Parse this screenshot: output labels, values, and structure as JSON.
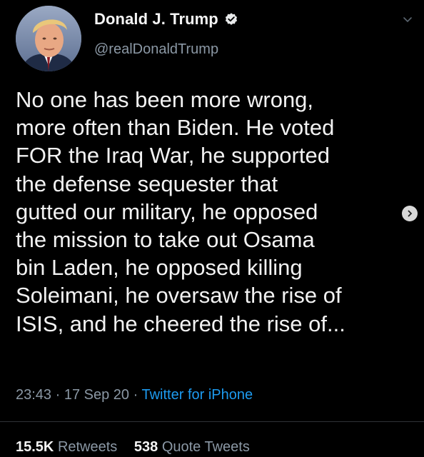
{
  "author": {
    "display_name": "Donald J. Trump",
    "handle": "@realDonaldTrump",
    "verified": true
  },
  "tweet": {
    "lines": [
      "No one has been more wrong,",
      "more often than Biden. He voted",
      "FOR the Iraq War, he supported",
      "the defense sequester that",
      "gutted our military, he opposed",
      "the mission to take out Osama",
      "bin Laden, he opposed killing",
      "Soleimani, he oversaw the rise of",
      "ISIS, and he cheered the rise of..."
    ]
  },
  "meta": {
    "time": "23:43",
    "separator": "·",
    "date": "17 Sep 20",
    "source": "Twitter for iPhone"
  },
  "stats": {
    "retweets_count": "15.5K",
    "retweets_label": "Retweets",
    "quote_count": "538",
    "quote_label": "Quote Tweets"
  },
  "colors": {
    "background": "#000000",
    "text": "#f2f2f2",
    "muted": "#8b98a5",
    "accent": "#1d9bf0"
  },
  "icons": {
    "verified": "verified-badge-icon",
    "menu": "chevron-down-icon",
    "next": "chevron-right-icon"
  }
}
